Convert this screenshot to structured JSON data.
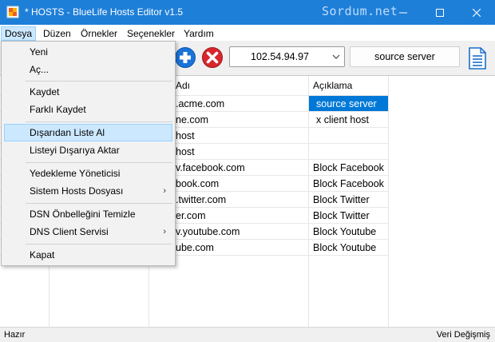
{
  "window": {
    "title": "* HOSTS - BlueLife Hosts Editor v1.5",
    "watermark": "Sordum.net",
    "accent": "#1e7fd8"
  },
  "menubar": {
    "items": [
      "Dosya",
      "Düzen",
      "Örnekler",
      "Seçenekler",
      "Yardım"
    ]
  },
  "toolbar": {
    "add_icon": "plus-circle-icon",
    "remove_icon": "x-circle-icon",
    "ip_value": "102.54.94.97",
    "source_value": "source server",
    "doc_icon": "document-icon"
  },
  "grid": {
    "headers": {
      "host": "Adı",
      "desc": "Açıklama"
    },
    "rows": [
      {
        "host": ".acme.com",
        "desc": "source server",
        "selected": true
      },
      {
        "host": "ne.com",
        "desc": "x client host"
      },
      {
        "host": "host",
        "desc": ""
      },
      {
        "host": "host",
        "desc": ""
      },
      {
        "host": "v.facebook.com",
        "desc": "Block Facebook"
      },
      {
        "host": "book.com",
        "desc": "Block Facebook"
      },
      {
        "host": ".twitter.com",
        "desc": "Block Twitter"
      },
      {
        "host": "er.com",
        "desc": "Block Twitter"
      },
      {
        "host": "v.youtube.com",
        "desc": "Block Youtube"
      },
      {
        "host": "ube.com",
        "desc": "Block Youtube"
      }
    ]
  },
  "file_menu": {
    "groups": [
      [
        "Yeni",
        "Aç..."
      ],
      [
        "Kaydet",
        "Farklı Kaydet"
      ],
      [
        "Dışarıdan Liste Al",
        "Listeyi Dışarıya Aktar"
      ],
      [
        "Yedekleme Yöneticisi",
        "Sistem Hosts Dosyası"
      ],
      [
        "DSN Önbelleğini Temizle",
        "DNS Client Servisi"
      ],
      [
        "Kapat"
      ]
    ],
    "submenu_arrow": "›"
  },
  "statusbar": {
    "left": "Hazır",
    "right": "Veri Değişmiş"
  }
}
